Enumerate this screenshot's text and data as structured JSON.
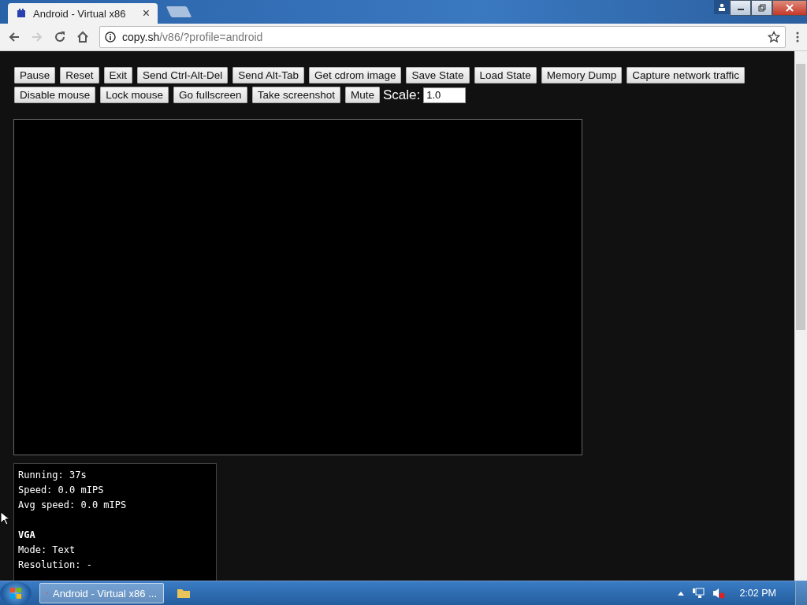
{
  "tab": {
    "title": "Android - Virtual x86",
    "close": "×"
  },
  "address": {
    "host": "copy.sh",
    "path": "/v86/?profile=android"
  },
  "buttons": [
    [
      "Pause",
      "Reset",
      "Exit",
      "Send Ctrl-Alt-Del",
      "Send Alt-Tab",
      "Get cdrom image",
      "Save State",
      "Load State",
      "Memory Dump",
      "Capture network traffic"
    ],
    [
      "Disable mouse",
      "Lock mouse",
      "Go fullscreen",
      "Take screenshot",
      "Mute"
    ]
  ],
  "scale": {
    "label": "Scale:",
    "value": "1.0"
  },
  "info": [
    {
      "lines": [
        "Running: 37s",
        "Speed: 0.0 mIPS",
        "Avg speed: 0.0 mIPS"
      ]
    },
    {
      "heading": "VGA",
      "lines": [
        "Mode: Text",
        "Resolution: -"
      ]
    }
  ],
  "taskbar": {
    "app": "Android - Virtual x86 ...",
    "clock": "2:02 PM"
  }
}
